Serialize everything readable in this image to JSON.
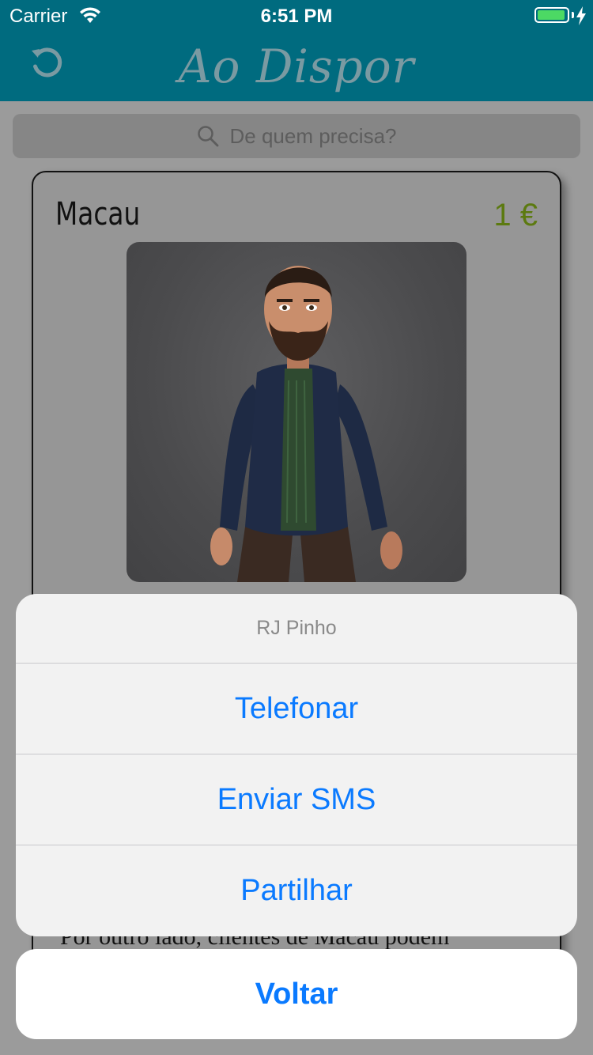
{
  "status_bar": {
    "carrier": "Carrier",
    "time": "6:51 PM",
    "battery_level": 0.95,
    "battery_color": "#4cd964"
  },
  "nav_bar": {
    "title": "Ao Dispor",
    "left_icon": "refresh-icon",
    "background": "#006b7f"
  },
  "search": {
    "placeholder": "De quem precisa?",
    "icon": "search-icon"
  },
  "card": {
    "name": "Macau",
    "price": "1 €",
    "price_color": "#5c7a10",
    "text_peek": "Por outro lado, clientes de Macau podem"
  },
  "action_sheet": {
    "title": "RJ Pinho",
    "actions": [
      "Telefonar",
      "Enviar SMS",
      "Partilhar"
    ],
    "cancel": "Voltar",
    "action_color": "#0a7aff"
  }
}
